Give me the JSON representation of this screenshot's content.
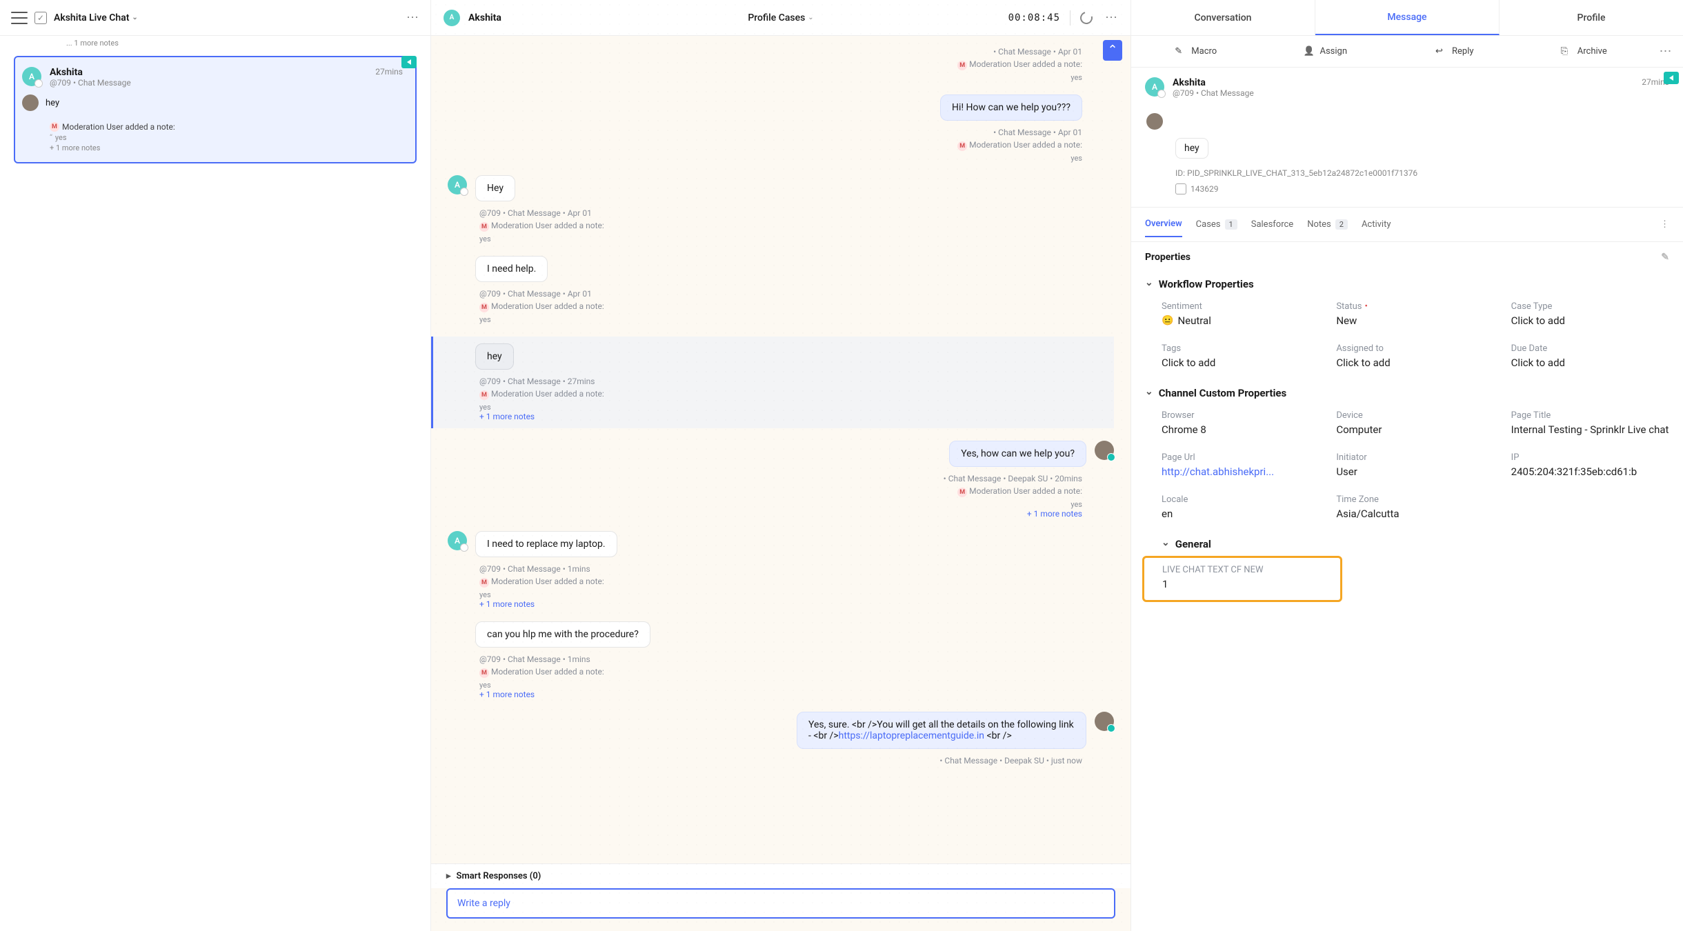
{
  "left": {
    "title": "Akshita Live Chat",
    "frag_more": "... 1 more notes",
    "card": {
      "name": "Akshita",
      "sub": "@709 • Chat Message",
      "time": "27mins",
      "preview": "hey",
      "note_user": "Moderation User added a note:",
      "note_quote": "yes",
      "plus_note": "+ 1 more notes"
    }
  },
  "center": {
    "person": "Akshita",
    "title": "Profile Cases",
    "timer": "00:08:45",
    "top_meta1": "• Chat Message • Apr 01",
    "top_mod": "Moderation User added a note:",
    "top_quote": "yes",
    "help_bubble": "Hi! How can we help you???",
    "help_meta": "• Chat Message • Apr 01",
    "help_mod": "Moderation User added a note:",
    "help_quote": "yes",
    "m1": {
      "text": "Hey",
      "meta": "@709 • Chat Message • Apr 01",
      "mod": "Moderation User added a note:",
      "quote": "yes"
    },
    "m2": {
      "text": "I need help.",
      "meta": "@709 • Chat Message • Apr 01",
      "mod": "Moderation User added a note:",
      "quote": "yes"
    },
    "m3": {
      "text": "hey",
      "meta": "@709 • Chat Message • 27mins",
      "mod": "Moderation User added a note:",
      "quote": "yes",
      "more": "+ 1 more notes"
    },
    "a1": {
      "text": "Yes, how can we help you?",
      "meta": "• Chat Message • Deepak SU • 20mins",
      "mod": "Moderation User added a note:",
      "quote": "yes",
      "more": "+ 1 more notes"
    },
    "m4": {
      "text": "I need to replace my laptop.",
      "meta": "@709 • Chat Message • 1mins",
      "mod": "Moderation User added a note:",
      "quote": "yes",
      "more": "+ 1 more notes"
    },
    "m5": {
      "text": "can you hlp me with the procedure?",
      "meta": "@709 • Chat Message • 1mins",
      "mod": "Moderation User added a note:",
      "quote": "yes",
      "more": "+ 1 more notes"
    },
    "a2": {
      "pre": "Yes, sure. <br />You will get all the details on the following link - <br />",
      "link": "https://laptopreplacementguide.in",
      "post": " <br />",
      "meta": "• Chat Message • Deepak SU • just now"
    },
    "smart": "Smart Responses (0)",
    "reply_placeholder": "Write a reply"
  },
  "right": {
    "tabs": {
      "conversation": "Conversation",
      "message": "Message",
      "profile": "Profile"
    },
    "actions": {
      "macro": "Macro",
      "assign": "Assign",
      "reply": "Reply",
      "archive": "Archive"
    },
    "info": {
      "name": "Akshita",
      "sub": "@709 • Chat Message",
      "time": "27mins",
      "hey": "hey",
      "id_label": "ID: PID_SPRINKLR_LIVE_CHAT_313_5eb12a24872c1e0001f71376",
      "chip": "143629"
    },
    "subtabs": {
      "overview": "Overview",
      "cases": "Cases",
      "cases_n": "1",
      "salesforce": "Salesforce",
      "notes": "Notes",
      "notes_n": "2",
      "activity": "Activity"
    },
    "props_hdr": "Properties",
    "wf_hdr": "Workflow Properties",
    "wf": {
      "sentiment_l": "Sentiment",
      "sentiment_v": "Neutral",
      "status_l": "Status",
      "status_v": "New",
      "casetype_l": "Case Type",
      "casetype_v": "Click to add",
      "tags_l": "Tags",
      "tags_v": "Click to add",
      "assigned_l": "Assigned to",
      "assigned_v": "Click to add",
      "due_l": "Due Date",
      "due_v": "Click to add"
    },
    "cc_hdr": "Channel Custom Properties",
    "cc": {
      "browser_l": "Browser",
      "browser_v": "Chrome 8",
      "device_l": "Device",
      "device_v": "Computer",
      "pagetitle_l": "Page Title",
      "pagetitle_v": "Internal Testing - Sprinklr Live chat",
      "pageurl_l": "Page Url",
      "pageurl_v": "http://chat.abhishekpri...",
      "initiator_l": "Initiator",
      "initiator_v": "User",
      "ip_l": "IP",
      "ip_v": "2405:204:321f:35eb:cd61:b",
      "locale_l": "Locale",
      "locale_v": "en",
      "tz_l": "Time Zone",
      "tz_v": "Asia/Calcutta"
    },
    "gen_hdr": "General",
    "gen": {
      "cf_l": "LIVE CHAT TEXT CF NEW",
      "cf_v": "1"
    }
  }
}
